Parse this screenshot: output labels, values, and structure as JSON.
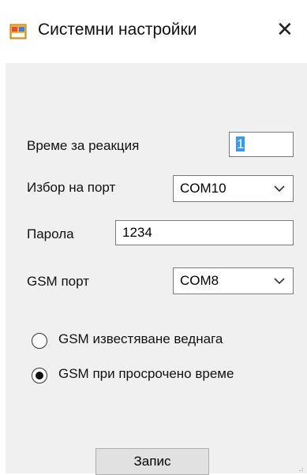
{
  "window": {
    "title": "Системни настройки",
    "close_glyph": "✕"
  },
  "form": {
    "reaction_time": {
      "label": "Време за реакция",
      "value": "1"
    },
    "port_select": {
      "label": "Избор на порт",
      "value": "COM10"
    },
    "password": {
      "label": "Парола",
      "value": "1234"
    },
    "gsm_port": {
      "label": "GSM порт",
      "value": "COM8"
    },
    "radio_options": [
      {
        "label": "GSM известяване веднага",
        "checked": false
      },
      {
        "label": "GSM при просрочено време",
        "checked": true
      }
    ],
    "save_label": "Запис"
  },
  "icons": {
    "app": "window-app-icon",
    "close": "close-icon",
    "dropdown": "chevron-down-icon"
  },
  "colors": {
    "client_bg": "#f0f0f0",
    "selection": "#3399ff",
    "button_bg": "#e1e1e1"
  }
}
